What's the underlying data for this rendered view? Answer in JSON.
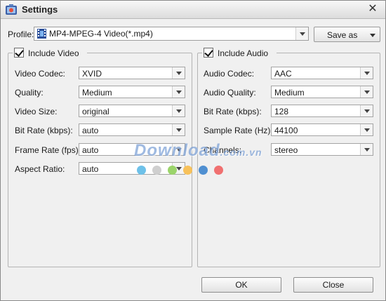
{
  "window": {
    "title": "Settings",
    "close_glyph": "✕"
  },
  "profile": {
    "label": "Profile:",
    "value": "MP4-MPEG-4 Video(*.mp4)",
    "save_as_label": "Save as"
  },
  "video": {
    "header": "Include Video",
    "checked": true,
    "rows": [
      {
        "label": "Video Codec:",
        "value": "XVID"
      },
      {
        "label": "Quality:",
        "value": "Medium"
      },
      {
        "label": "Video Size:",
        "value": "original"
      },
      {
        "label": "Bit Rate (kbps):",
        "value": "auto"
      },
      {
        "label": "Frame Rate (fps):",
        "value": "auto"
      },
      {
        "label": "Aspect Ratio:",
        "value": "auto"
      }
    ]
  },
  "audio": {
    "header": "Include Audio",
    "checked": true,
    "rows": [
      {
        "label": "Audio Codec:",
        "value": "AAC"
      },
      {
        "label": "Audio Quality:",
        "value": "Medium"
      },
      {
        "label": "Bit Rate (kbps):",
        "value": "128"
      },
      {
        "label": "Sample Rate (Hz):",
        "value": "44100"
      },
      {
        "label": "Channels:",
        "value": "stereo"
      }
    ]
  },
  "buttons": {
    "ok": "OK",
    "close": "Close"
  },
  "watermark": {
    "text": "Download",
    "suffix": ".com.vn"
  },
  "colors": {
    "watermark_dots": [
      "#6ec1e9",
      "#cfcfcf",
      "#9bd46a",
      "#f7c15a",
      "#4f8fd1",
      "#f07070"
    ]
  },
  "icons": {
    "app": "settings-app-icon",
    "profile": "video-film-icon",
    "close": "close-icon"
  }
}
